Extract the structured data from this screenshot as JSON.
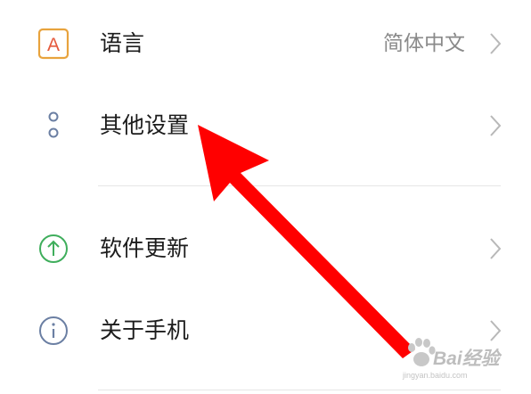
{
  "settings": {
    "language": {
      "label": "语言",
      "value": "简体中文",
      "icon": "letter-a-icon",
      "icon_letter": "A"
    },
    "other": {
      "label": "其他设置",
      "icon": "two-dots-icon"
    },
    "update": {
      "label": "软件更新",
      "icon": "arrow-up-circle-icon"
    },
    "about": {
      "label": "关于手机",
      "icon": "info-circle-icon"
    }
  },
  "colors": {
    "text_primary": "#1c1c1c",
    "text_secondary": "#8a8a8a",
    "divider": "#e6e6e6",
    "chevron": "#b8b8b8",
    "language_icon": "#e8a33d",
    "language_icon_letter": "#e5593c",
    "other_icon": "#6b7fa3",
    "update_icon": "#3fae5c",
    "about_icon": "#6b7fa3",
    "annotation_arrow": "#ff0000",
    "watermark": "#bdbdbd"
  },
  "watermark": {
    "brand": "Bai",
    "brand_suffix": "经验",
    "sub": "jingyan.baidu.com"
  }
}
